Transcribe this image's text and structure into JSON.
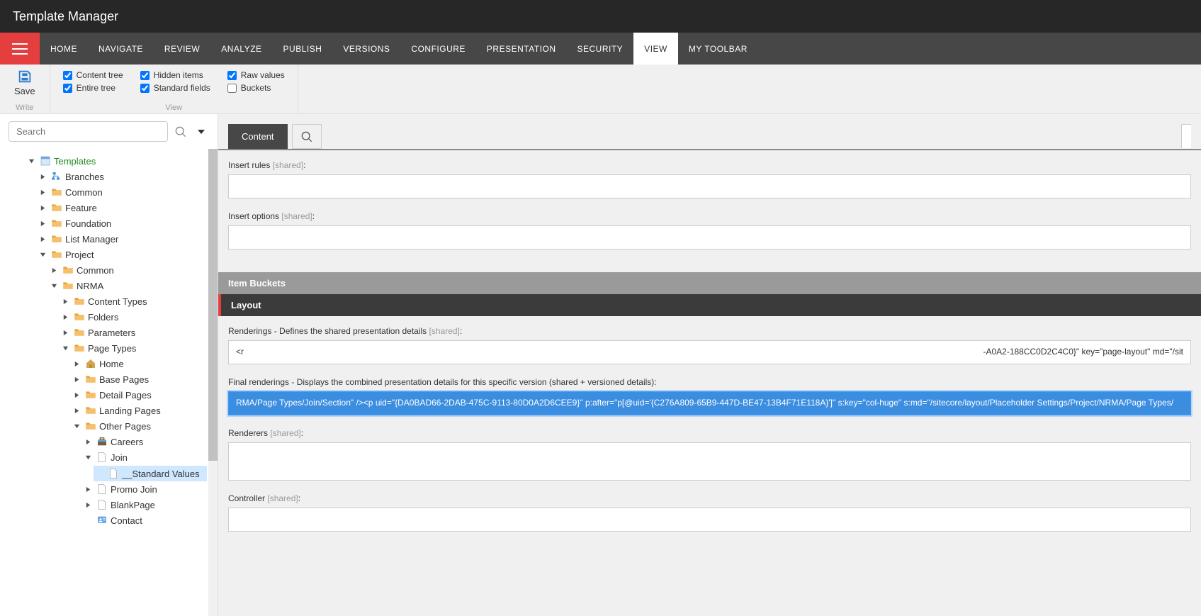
{
  "title": "Template Manager",
  "menu": {
    "items": [
      "HOME",
      "NAVIGATE",
      "REVIEW",
      "ANALYZE",
      "PUBLISH",
      "VERSIONS",
      "CONFIGURE",
      "PRESENTATION",
      "SECURITY",
      "VIEW",
      "MY TOOLBAR"
    ],
    "active": "VIEW"
  },
  "ribbon": {
    "save_label": "Save",
    "write_label": "Write",
    "view_label": "View",
    "checks": {
      "content_tree": "Content tree",
      "entire_tree": "Entire tree",
      "hidden_items": "Hidden items",
      "standard_fields": "Standard fields",
      "raw_values": "Raw values",
      "buckets": "Buckets"
    }
  },
  "search": {
    "placeholder": "Search"
  },
  "tree": {
    "root": "Templates",
    "branches": "Branches",
    "common": "Common",
    "feature": "Feature",
    "foundation": "Foundation",
    "list_manager": "List Manager",
    "project": "Project",
    "project_common": "Common",
    "nrma": "NRMA",
    "content_types": "Content Types",
    "folders": "Folders",
    "parameters": "Parameters",
    "page_types": "Page Types",
    "home": "Home",
    "base_pages": "Base Pages",
    "detail_pages": "Detail Pages",
    "landing_pages": "Landing Pages",
    "other_pages": "Other Pages",
    "careers": "Careers",
    "join": "Join",
    "standard_values": "__Standard Values",
    "promo_join": "Promo Join",
    "blankpage": "BlankPage",
    "contact": "Contact"
  },
  "tabs": {
    "content": "Content"
  },
  "sections": {
    "item_buckets": "Item Buckets",
    "layout": "Layout"
  },
  "fields": {
    "insert_rules": "Insert rules",
    "insert_options": "Insert options",
    "renderings": "Renderings - Defines the shared presentation details",
    "final_renderings": "Final renderings - Displays the combined presentation details for this specific version (shared + versioned details):",
    "renderers": "Renderers",
    "controller": "Controller",
    "shared": "[shared]",
    "renderings_value_left": "<r",
    "renderings_value_right": "-A0A2-188CC0D2C4C0}\" key=\"page-layout\" md=\"/sit",
    "final_renderings_value": "RMA/Page Types/Join/Section\" /><p uid=\"{DA0BAD66-2DAB-475C-9113-80D0A2D6CEE9}\" p:after=\"p[@uid='{C276A809-65B9-447D-BE47-13B4F71E118A}']\" s:key=\"col-huge\" s:md=\"/sitecore/layout/Placeholder Settings/Project/NRMA/Page Types/"
  }
}
